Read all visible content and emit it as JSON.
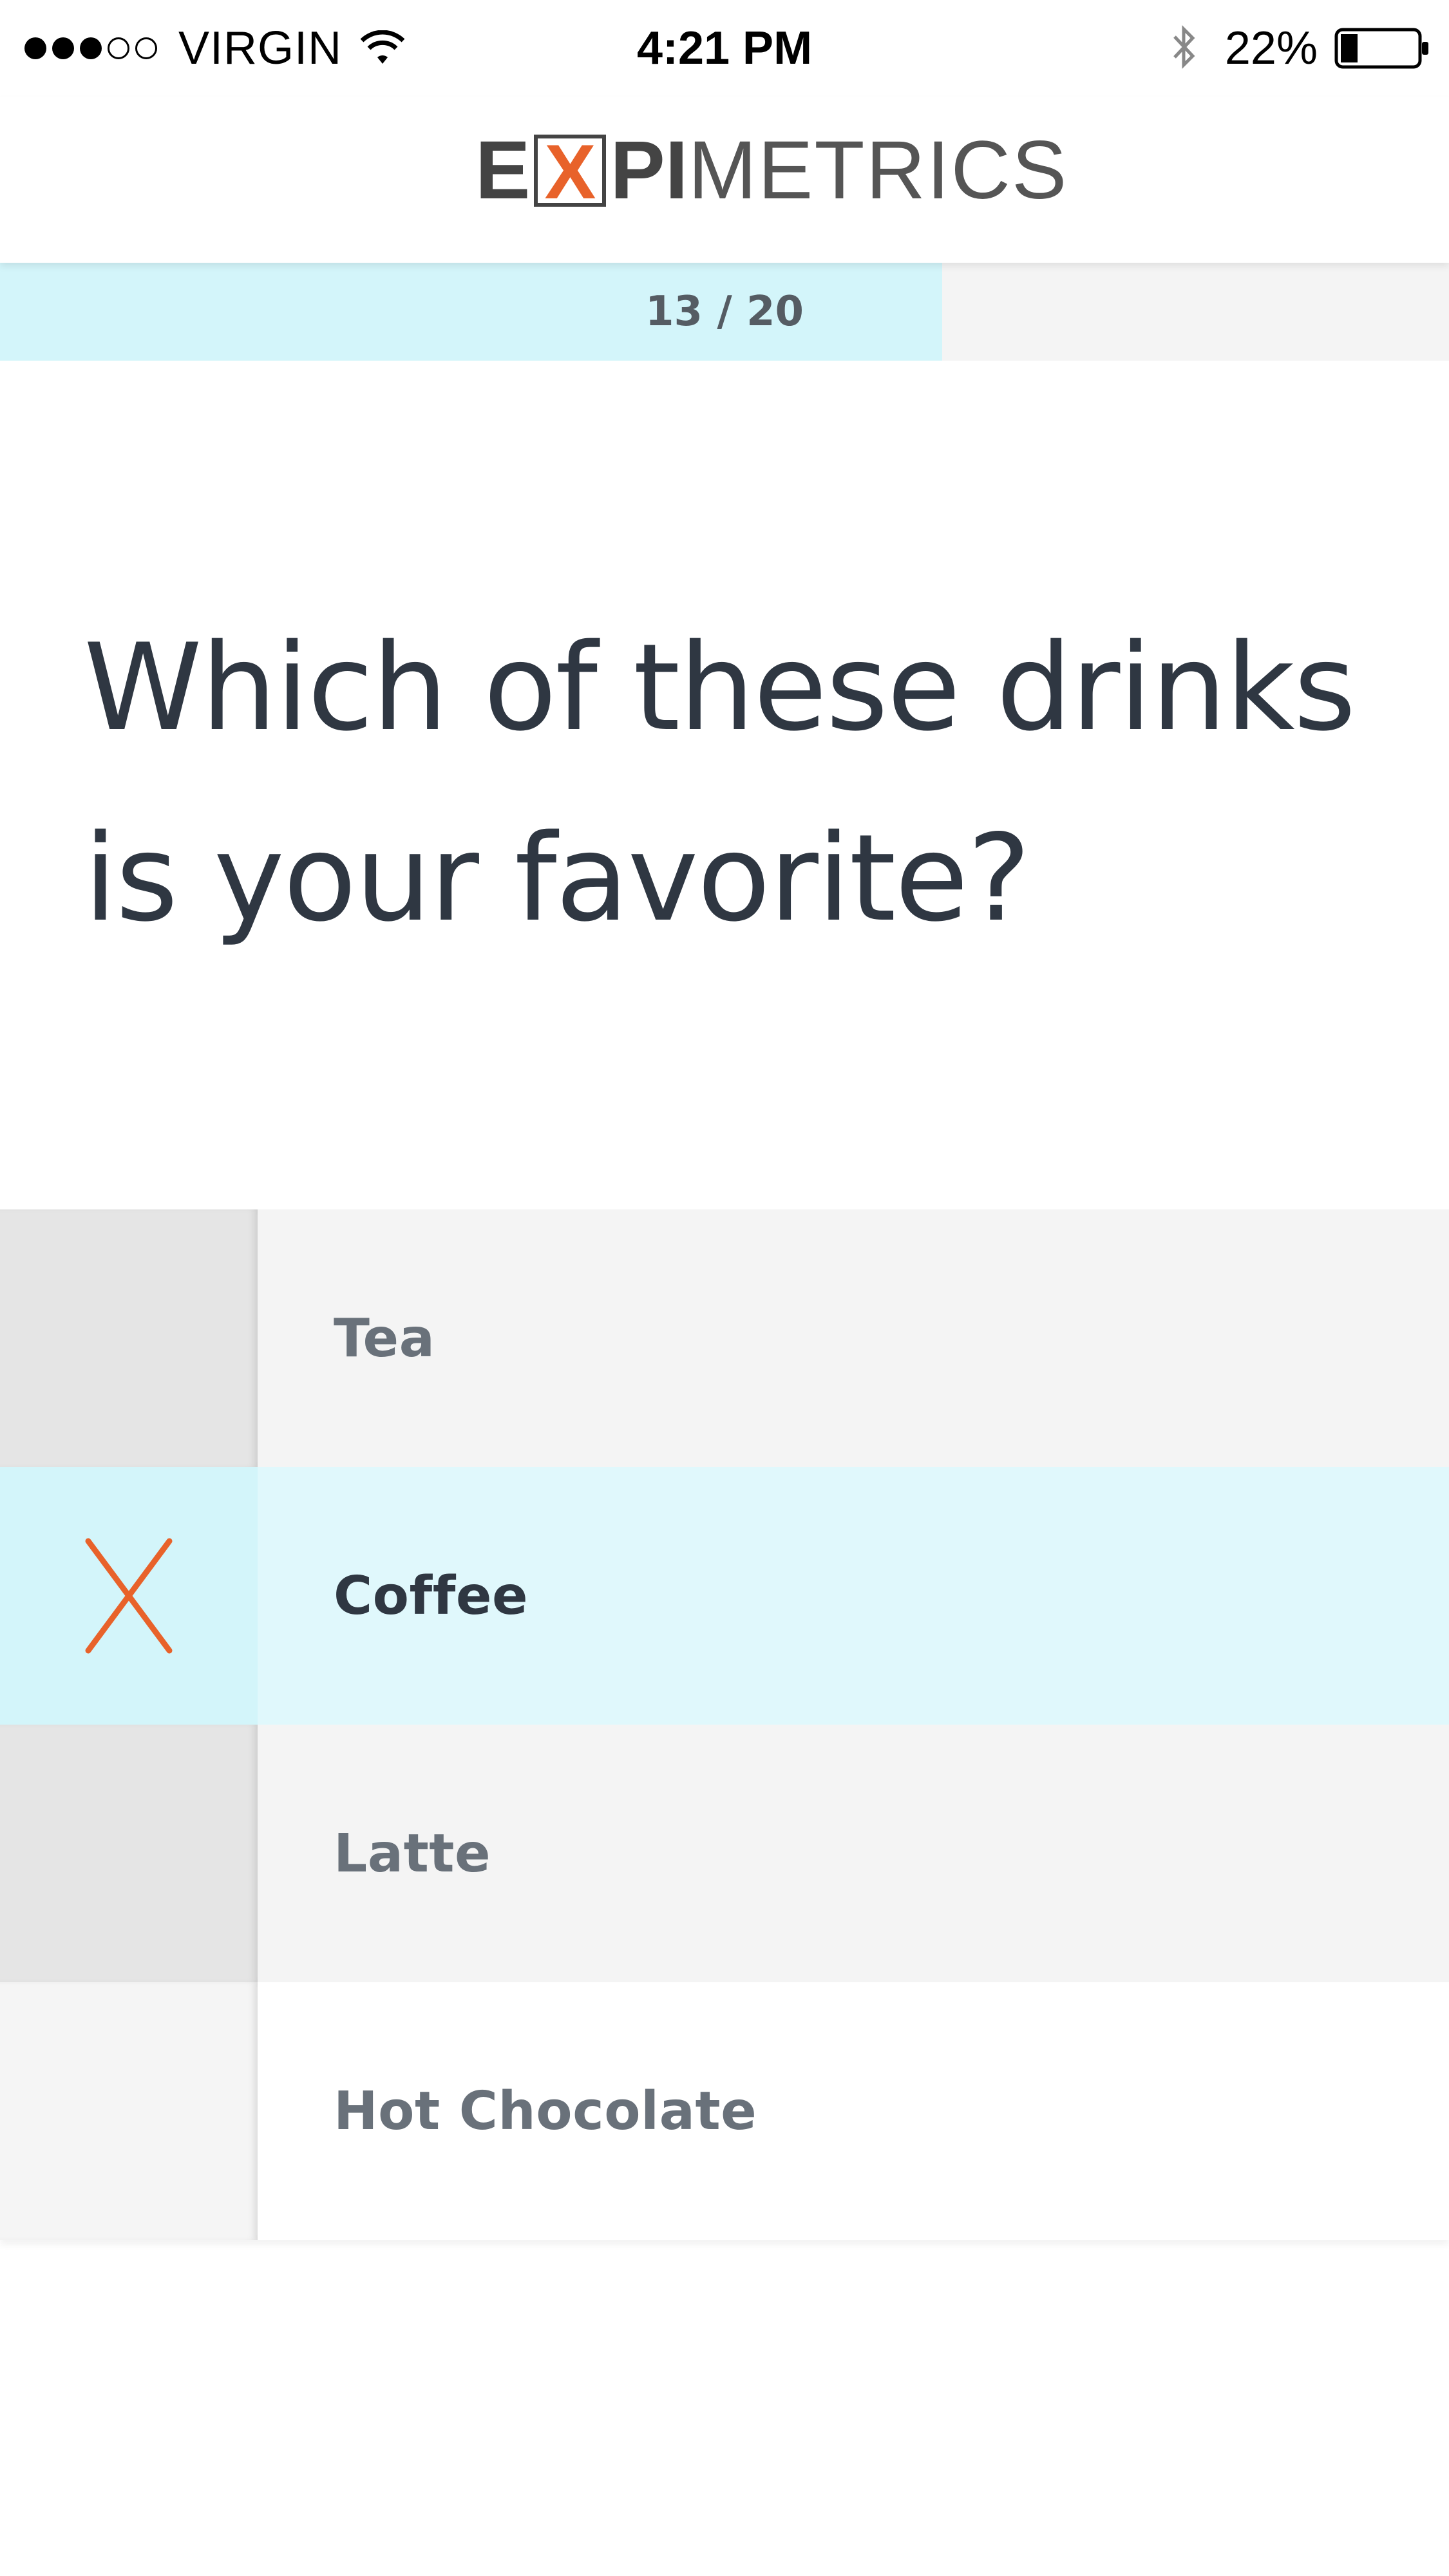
{
  "status_bar": {
    "signal_dots": [
      "full",
      "full",
      "full",
      "empty",
      "empty"
    ],
    "carrier": "VIRGIN",
    "time": "4:21 PM",
    "battery_percent": "22%",
    "battery_level": 0.22,
    "icons": [
      "wifi-icon",
      "bluetooth-icon",
      "battery-icon"
    ]
  },
  "header": {
    "logo_parts": {
      "e": "E",
      "x": "X",
      "pi": "PI",
      "metrics": "METRICS"
    },
    "logo_accent_color": "#e8622a"
  },
  "progress": {
    "text": "13 / 20",
    "current": 13,
    "total": 20,
    "fill_color": "#d3f5fa"
  },
  "question": {
    "line1": "Which of these drinks",
    "line2": "is your favorite?"
  },
  "options": [
    {
      "label": "Tea",
      "selected": false
    },
    {
      "label": "Coffee",
      "selected": true
    },
    {
      "label": "Latte",
      "selected": false
    },
    {
      "label": "Hot Chocolate",
      "selected": false
    }
  ],
  "colors": {
    "selected_background": "#e0f8fc",
    "selection_mark": "#e8622a",
    "text_dark": "#2f3742",
    "text_muted": "#69717a"
  }
}
